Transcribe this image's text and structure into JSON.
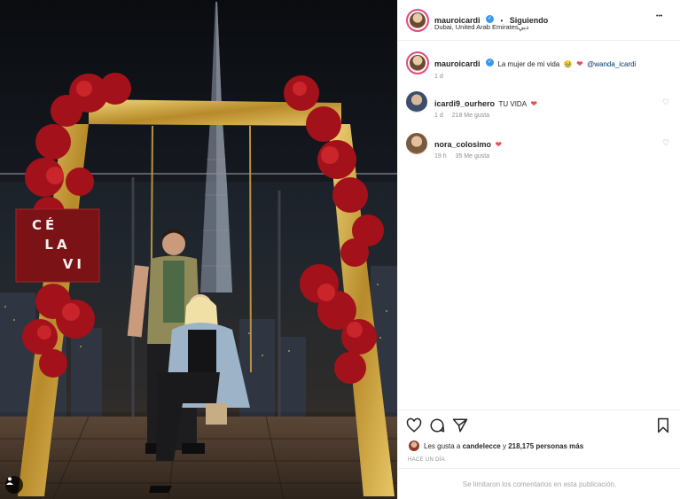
{
  "post": {
    "username": "mauroicardi",
    "follow_separator": "•",
    "follow_status": "Siguiendo",
    "location": "Dubai, United Arab Emiratesدبي",
    "more_options": "•••"
  },
  "caption": {
    "username": "mauroicardi",
    "text": "La mujer de mi vida",
    "emoji": "🥹",
    "heart": "❤",
    "mention": "@wanda_icardi",
    "time": "1 d"
  },
  "comments": [
    {
      "username": "icardi9_ourhero",
      "text": "TU VIDA",
      "heart": "❤",
      "time": "1 d",
      "likes": "218 Me gusta"
    },
    {
      "username": "nora_colosimo",
      "text": "",
      "heart": "❤",
      "time": "19 h",
      "likes": "35 Me gusta"
    }
  ],
  "likes_summary": {
    "prefix": "Les gusta a",
    "user": "candelecce",
    "connector": "y",
    "count": "218,175 personas más"
  },
  "post_time": "HACE UN DÍA",
  "comments_limited": "Se limitaron los comentarios en esta publicación.",
  "photo": {
    "sign_lines": [
      "CÉ",
      "LA",
      "VI"
    ]
  },
  "colors": {
    "verified": "#3897f0",
    "heart": "#ed4956",
    "link": "#00376b",
    "story_ring": "#e84a86",
    "sign": "#7a1216",
    "flowers": "#a3121a",
    "frame_gold": "#c9a13a"
  },
  "icons": {
    "more": "more-dots-icon",
    "like": "heart-outline-icon",
    "comment": "comment-bubble-icon",
    "share": "paper-plane-icon",
    "save": "bookmark-icon",
    "verified": "verified-badge-icon",
    "instagram": "instagram-user-icon"
  }
}
